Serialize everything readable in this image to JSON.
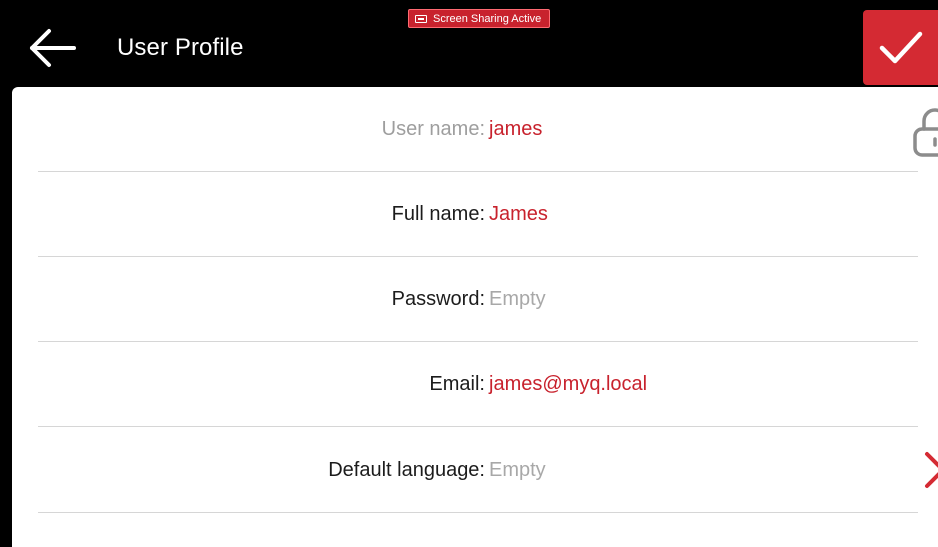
{
  "header": {
    "title": "User Profile",
    "back_icon": "arrow-left-icon",
    "confirm_icon": "checkmark-icon",
    "screen_sharing_badge": "Screen Sharing Active"
  },
  "colors": {
    "accent": "#d42a33",
    "value_text": "#c8222d",
    "header_bg": "#000000",
    "empty_text": "#a8a8a8"
  },
  "profile": {
    "rows": [
      {
        "label": "User name:",
        "value": "james",
        "locked": true
      },
      {
        "label": "Full name:",
        "value": "James"
      },
      {
        "label": "Password:",
        "value": "Empty"
      },
      {
        "label": "Email:",
        "value": "james@myq.local"
      },
      {
        "label": "Default language:",
        "value": "Empty",
        "has_chevron": true
      }
    ]
  }
}
